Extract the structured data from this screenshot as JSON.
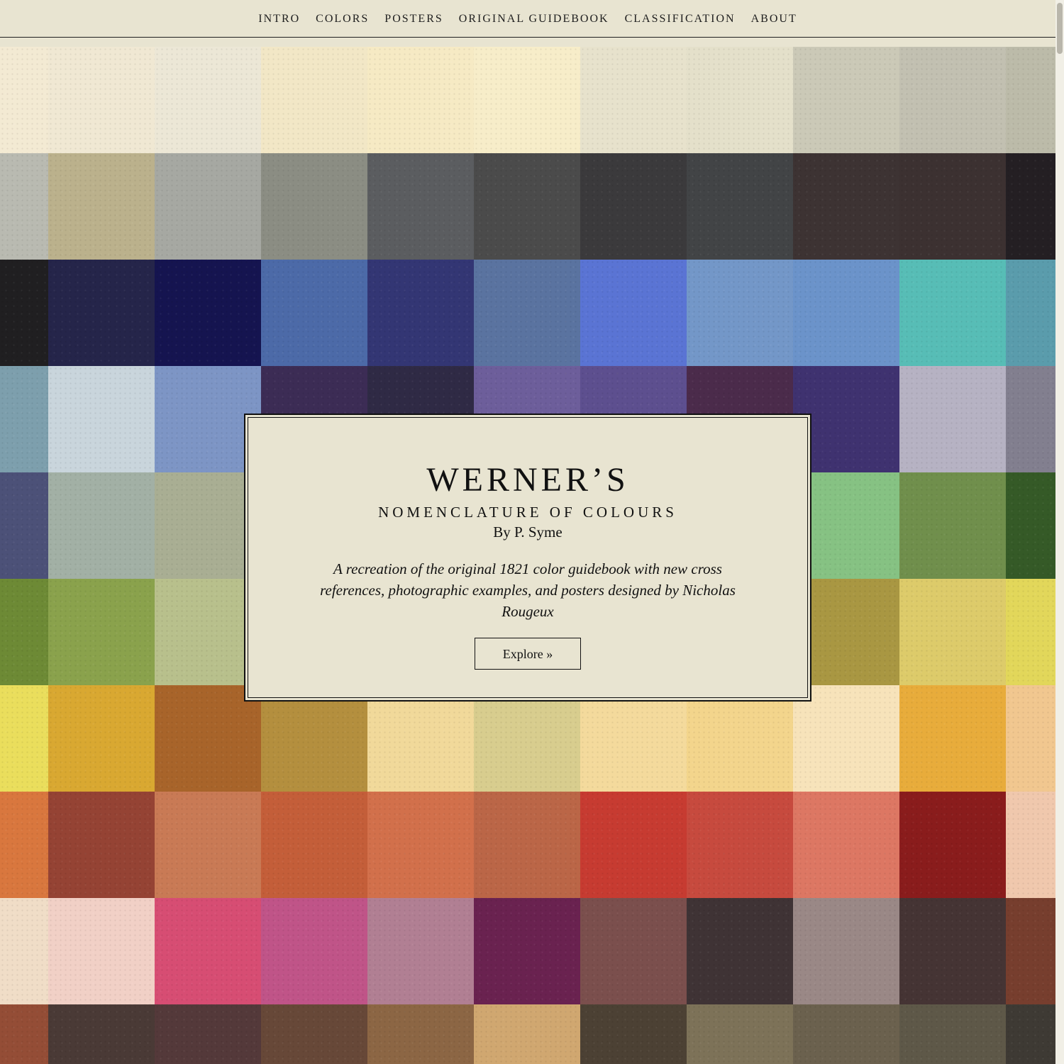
{
  "nav": {
    "items": [
      {
        "label": "INTRO",
        "name": "nav-intro"
      },
      {
        "label": "COLORS",
        "name": "nav-colors"
      },
      {
        "label": "POSTERS",
        "name": "nav-posters"
      },
      {
        "label": "ORIGINAL GUIDEBOOK",
        "name": "nav-original-guidebook"
      },
      {
        "label": "CLASSIFICATION",
        "name": "nav-classification"
      },
      {
        "label": "ABOUT",
        "name": "nav-about"
      }
    ]
  },
  "hero": {
    "title": "WERNER’S",
    "subtitle": "NOMENCLATURE OF COLOURS",
    "author": "By P. Syme",
    "tagline": "A recreation of the original 1821 color guidebook with new cross references, photographic examples, and posters designed by Nicholas Rougeux",
    "button_label": "Explore »"
  },
  "colors": {
    "page_bg": "#e8e4d1",
    "ink": "#111111"
  },
  "swatch_grid": {
    "rows": [
      [
        "#f3ead3",
        "#f0e8d3",
        "#ece7d6",
        "#f2e7c6",
        "#f6eac4",
        "#f7edc9",
        "#e7e2cc",
        "#e4e0ca",
        "#cbc9b7",
        "#c2c0b1",
        "#bcbba9"
      ],
      [
        "#b9bab1",
        "#bbb18c",
        "#a6a8a2",
        "#8b8d83",
        "#5b5d60",
        "#4b4b4b",
        "#3b3a3c",
        "#424446",
        "#3d3333",
        "#3c3131",
        "#241f23"
      ],
      [
        "#201f21",
        "#25254a",
        "#151450",
        "#4c6aa8",
        "#333674",
        "#5a73a0",
        "#5a74d4",
        "#7397c8",
        "#6b93ca",
        "#57bdb6",
        "#5a9cac"
      ],
      [
        "#7d9fad",
        "#c9d5dc",
        "#7d95c5",
        "#3c2c55",
        "#2f2a45",
        "#6d5e9b",
        "#5d4f8f",
        "#4b2b4b",
        "#3f3270",
        "#b6b2c3",
        "#827f8f"
      ],
      [
        "#4c5178",
        "#a2b0a5",
        "#a9ae93",
        "#c9c9b9",
        "#b7b7a9",
        "#8e9a7e",
        "#999a8c",
        "#9d9f8e",
        "#86c283",
        "#708f4c",
        "#355a27"
      ],
      [
        "#6d8a35",
        "#8aa24c",
        "#b8c08c",
        "#a7ab6f",
        "#c4b981",
        "#b3a561",
        "#a8a157",
        "#b4a95a",
        "#a99742",
        "#ddcb6a",
        "#e2d75a"
      ],
      [
        "#eade5c",
        "#d9a831",
        "#a8642a",
        "#b48f3e",
        "#f1d99a",
        "#d8cd8e",
        "#f4da9c",
        "#f3d58c",
        "#f7e3ba",
        "#e8ac3b",
        "#f1c78f"
      ],
      [
        "#d9773e",
        "#954334",
        "#c97a55",
        "#c45e39",
        "#d2704b",
        "#bb6647",
        "#c73b31",
        "#c74a3e",
        "#dd7763",
        "#8a1c1c",
        "#f0c8ad"
      ],
      [
        "#f0ddc7",
        "#f1d0c6",
        "#d74d73",
        "#c05488",
        "#b17f93",
        "#6a2250",
        "#7b4f4d",
        "#3f3335",
        "#9a8886",
        "#453434",
        "#773e2e"
      ],
      [
        "#944d36",
        "#4a3a36",
        "#54393a",
        "#674838",
        "#8c6644",
        "#d0a770",
        "#4c4134",
        "#7d7258",
        "#6b614e",
        "#5e5848",
        "#3e3a34"
      ]
    ]
  }
}
